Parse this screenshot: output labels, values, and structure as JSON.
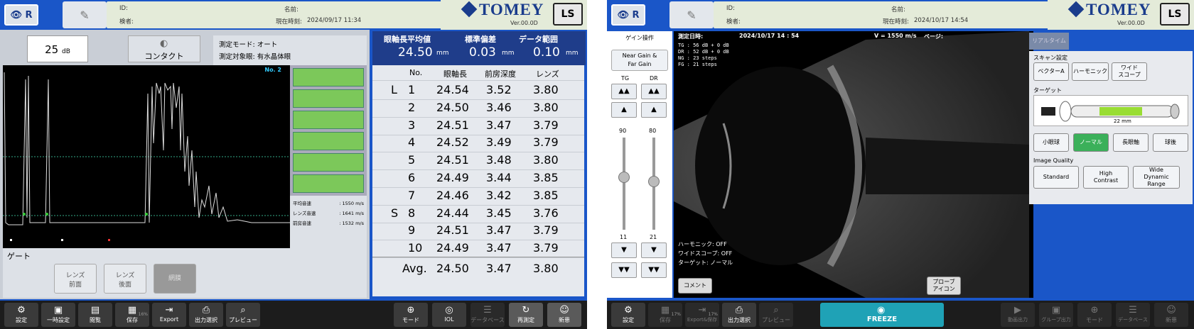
{
  "left_screen": {
    "eye_label": "R",
    "patient": {
      "id_label": "ID:",
      "name_label": "名前:",
      "examiner_label": "検者:",
      "datetime_label": "現在時刻:",
      "datetime": "2024/09/17 11:34"
    },
    "brand": "TOMEY",
    "version": "Ver.00.0D",
    "ls_label": "LS",
    "gain_value": "25",
    "gain_unit": "dB",
    "contact_label": "コンタクト",
    "mode_label": "測定モード:",
    "mode_value": "オート",
    "target_label": "測定対象眼:",
    "target_value": "有水晶体眼",
    "trace_label": "No. 2",
    "speeds": [
      {
        "label": "平均音速",
        "value": "1550 m/s"
      },
      {
        "label": "レンズ音速",
        "value": "1641 m/s"
      },
      {
        "label": "前房音速",
        "value": "1532 m/s"
      }
    ],
    "gate_label": "ゲート",
    "gate_buttons": [
      "レンズ\n前面",
      "レンズ\n後面",
      "網膜"
    ],
    "stats": {
      "h1": "眼軸長平均値",
      "h2": "標準偏差",
      "h3": "データ範囲",
      "v1": "24.50",
      "v2": "0.03",
      "v3": "0.10",
      "unit": "mm"
    },
    "table_headers": [
      "No.",
      "眼軸長",
      "前房深度",
      "レンズ"
    ],
    "rows": [
      {
        "mark": "L",
        "no": "1",
        "al": "24.54",
        "acd": "3.52",
        "lens": "3.80"
      },
      {
        "mark": "",
        "no": "2",
        "al": "24.50",
        "acd": "3.46",
        "lens": "3.80"
      },
      {
        "mark": "",
        "no": "3",
        "al": "24.51",
        "acd": "3.47",
        "lens": "3.79"
      },
      {
        "mark": "",
        "no": "4",
        "al": "24.52",
        "acd": "3.49",
        "lens": "3.79"
      },
      {
        "mark": "",
        "no": "5",
        "al": "24.51",
        "acd": "3.48",
        "lens": "3.80"
      },
      {
        "mark": "",
        "no": "6",
        "al": "24.49",
        "acd": "3.44",
        "lens": "3.85"
      },
      {
        "mark": "",
        "no": "7",
        "al": "24.46",
        "acd": "3.42",
        "lens": "3.85"
      },
      {
        "mark": "S",
        "no": "8",
        "al": "24.44",
        "acd": "3.45",
        "lens": "3.76"
      },
      {
        "mark": "",
        "no": "9",
        "al": "24.51",
        "acd": "3.47",
        "lens": "3.79"
      },
      {
        "mark": "",
        "no": "10",
        "al": "24.49",
        "acd": "3.47",
        "lens": "3.79"
      }
    ],
    "avg": {
      "label": "Avg.",
      "al": "24.50",
      "acd": "3.47",
      "lens": "3.80"
    },
    "toolbar_left": [
      "設定",
      "一時設定",
      "閲覧",
      "保存",
      "Export",
      "出力選択",
      "プレビュー"
    ],
    "save_pct": "16%",
    "toolbar_right": [
      "モード",
      "IOL",
      "データベース",
      "再測定",
      "新患"
    ]
  },
  "right_screen": {
    "eye_label": "R",
    "patient": {
      "id_label": "ID:",
      "name_label": "名前:",
      "examiner_label": "検者:",
      "datetime_label": "現在時刻:",
      "datetime": "2024/10/17 14:54"
    },
    "brand": "TOMEY",
    "version": "Ver.00.0D",
    "ls_label": "LS",
    "gain_title": "ゲイン操作",
    "gain_button": "Near Gain &\nFar Gain",
    "tg_label": "TG",
    "dr_label": "DR",
    "tg_value": "90",
    "dr_value": "80",
    "tg_min": "11",
    "dr_min": "21",
    "measure_label": "測定日時:",
    "measure_datetime": "2024/10/17 14 : 54",
    "velocity": "V = 1550 m/s",
    "page_label": "ページ:",
    "params": [
      {
        "k": "TG",
        "v": "56",
        "u": "dB + 0 dB"
      },
      {
        "k": "DR",
        "v": "52",
        "u": "dB + 0 dB"
      },
      {
        "k": "NG",
        "v": "23",
        "u": "steps"
      },
      {
        "k": "FG",
        "v": "21",
        "u": "steps"
      }
    ],
    "status": [
      {
        "k": "ハーモニック:",
        "v": "OFF"
      },
      {
        "k": "ワイドスコープ:",
        "v": "OFF"
      },
      {
        "k": "ターゲット:",
        "v": "ノーマル"
      }
    ],
    "comment_button": "コメント",
    "probe_button": "プローブ\nアイコン",
    "realtime_tab": "リアルタイム",
    "scan_title": "スキャン設定",
    "scan_buttons": [
      "ベクターA",
      "ハーモニック",
      "ワイド\nスコープ"
    ],
    "target_title": "ターゲット",
    "target_mm": "22 mm",
    "target_buttons": [
      "小眼球",
      "ノーマル",
      "長眼軸",
      "球後"
    ],
    "iq_title": "Image Quality",
    "iq_buttons": [
      "Standard",
      "High\nContrast",
      "Wide\nDynamic\nRange"
    ],
    "toolbar_left": [
      "設定",
      "保存",
      "Export&保存",
      "出力選択",
      "プレビュー"
    ],
    "pct1": "17%",
    "pct2": "17%",
    "freeze": "FREEZE",
    "toolbar_right": [
      "動画出力",
      "グループ出力",
      "モード",
      "データベース",
      "新患"
    ]
  }
}
